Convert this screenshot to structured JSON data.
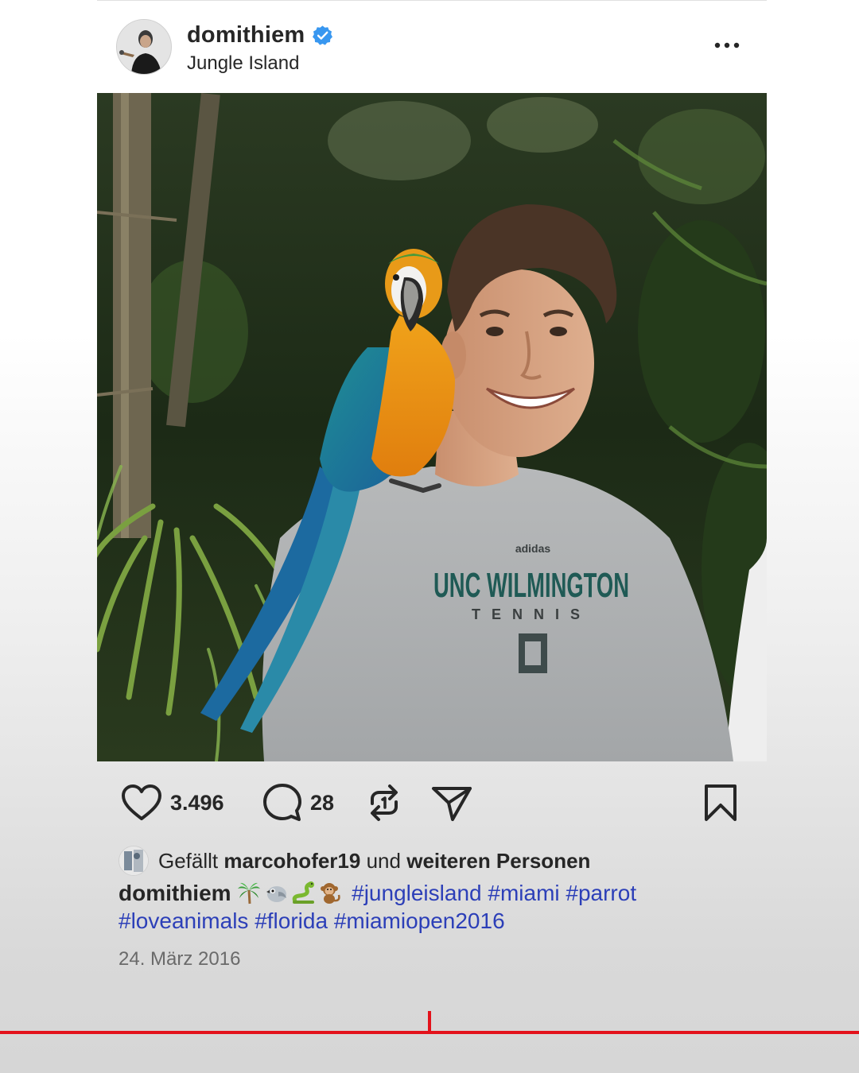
{
  "post": {
    "username": "domithiem",
    "verified": true,
    "location": "Jungle Island",
    "more_icon": "more-horizontal-icon",
    "image_alt": "Man in grey UNC Wilmington Tennis shirt with a blue-and-gold macaw on his shoulder, jungle foliage background",
    "image_shirt_text": {
      "brand": "adidas",
      "line1": "UNC WILMINGTON",
      "line2": "TENNIS"
    }
  },
  "actions": {
    "like_icon": "heart-icon",
    "like_count": "3.496",
    "comment_icon": "comment-icon",
    "comment_count": "28",
    "repost_icon": "repost-icon",
    "share_icon": "send-icon",
    "save_icon": "bookmark-icon"
  },
  "likes": {
    "prefix": "Gefällt",
    "user": "marcohofer19",
    "middle": "und",
    "suffix": "weiteren Personen"
  },
  "caption": {
    "author": "domithiem",
    "emojis": [
      "palm-tree",
      "bird",
      "snake",
      "monkey"
    ],
    "hashtags": [
      "#jungleisland",
      "#miami",
      "#parrot",
      "#loveanimals",
      "#florida",
      "#miamiopen2016"
    ]
  },
  "date": "24. März 2016",
  "colors": {
    "hashtag": "#2c3fb8",
    "verified": "#3897f0",
    "accent_line": "#e3121b",
    "text": "#262626",
    "muted": "#6a6a6a"
  }
}
